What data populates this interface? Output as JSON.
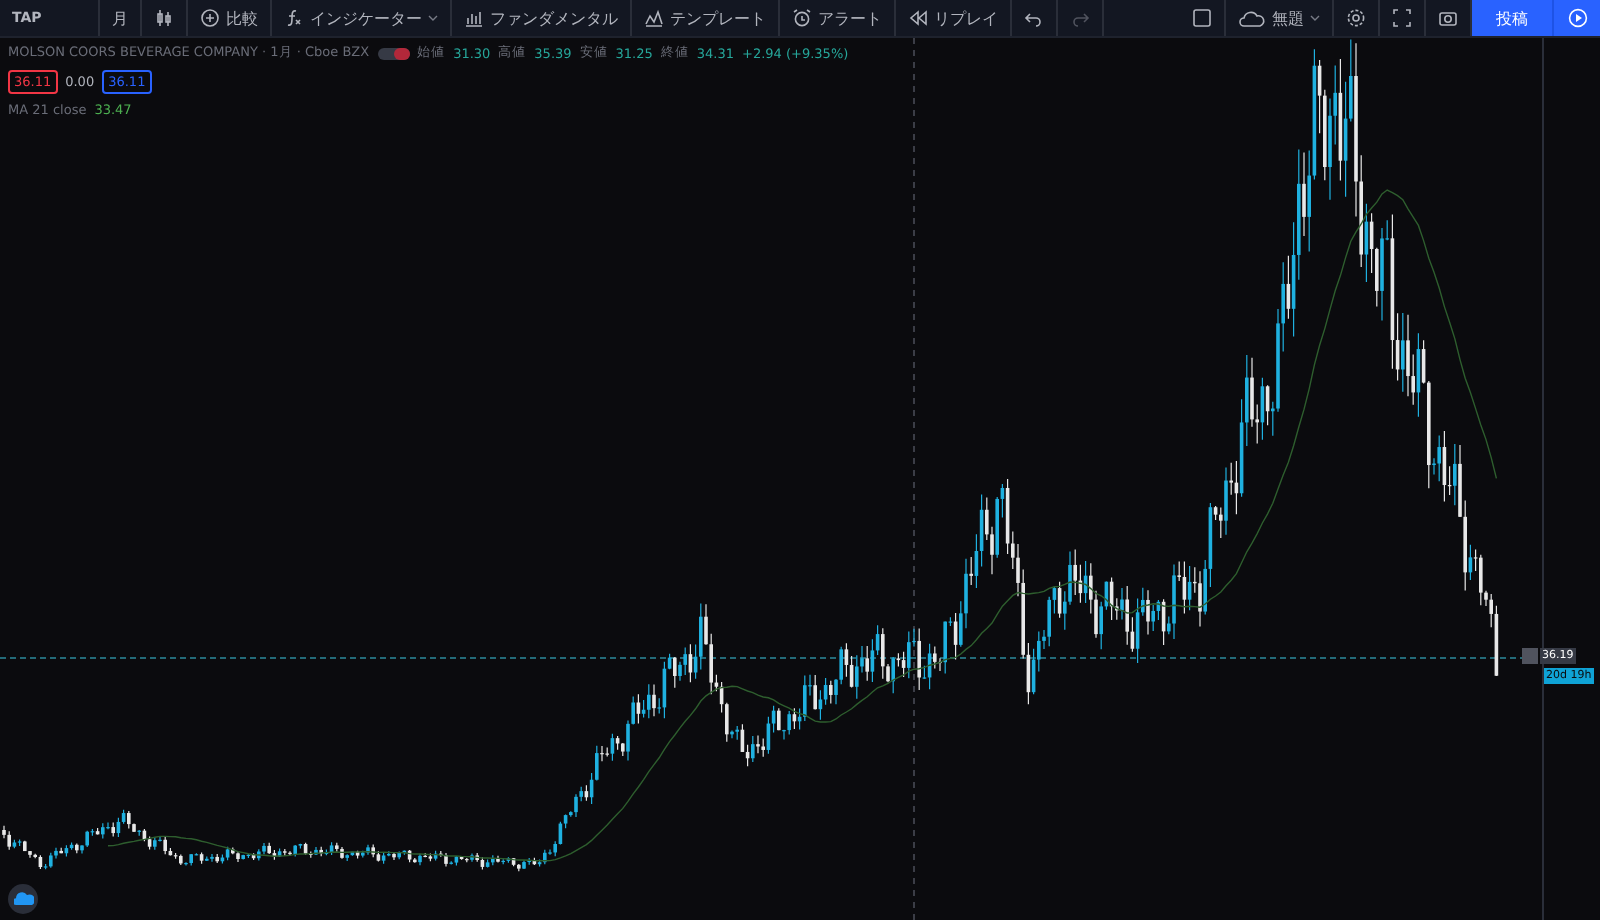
{
  "toolbar": {
    "symbol": "TAP",
    "interval": "月",
    "items": [
      {
        "kind": "compare",
        "label": "比較"
      },
      {
        "kind": "indicators",
        "label": "インジケーター"
      },
      {
        "kind": "fundamentals",
        "label": "ファンダメンタル"
      },
      {
        "kind": "templates",
        "label": "テンプレート"
      },
      {
        "kind": "alert",
        "label": "アラート"
      },
      {
        "kind": "replay",
        "label": "リプレイ"
      }
    ],
    "layout_name": "無題",
    "publish": "投稿"
  },
  "legend": {
    "title": "MOLSON COORS BEVERAGE COMPANY · 1月 · Cboe BZX",
    "ohlc": [
      {
        "label": "始値",
        "value": "31.30"
      },
      {
        "label": "高値",
        "value": "35.39"
      },
      {
        "label": "安値",
        "value": "31.25"
      },
      {
        "label": "終値",
        "value": "34.31"
      }
    ],
    "change": "+2.94 (+9.35%)",
    "bid": "36.11",
    "spread": "0.00",
    "ask": "36.11",
    "ma": {
      "label": "MA 21 close",
      "value": "33.47"
    }
  },
  "price_axis": {
    "last_price": "36.19",
    "countdown": "20d 19h"
  }
}
